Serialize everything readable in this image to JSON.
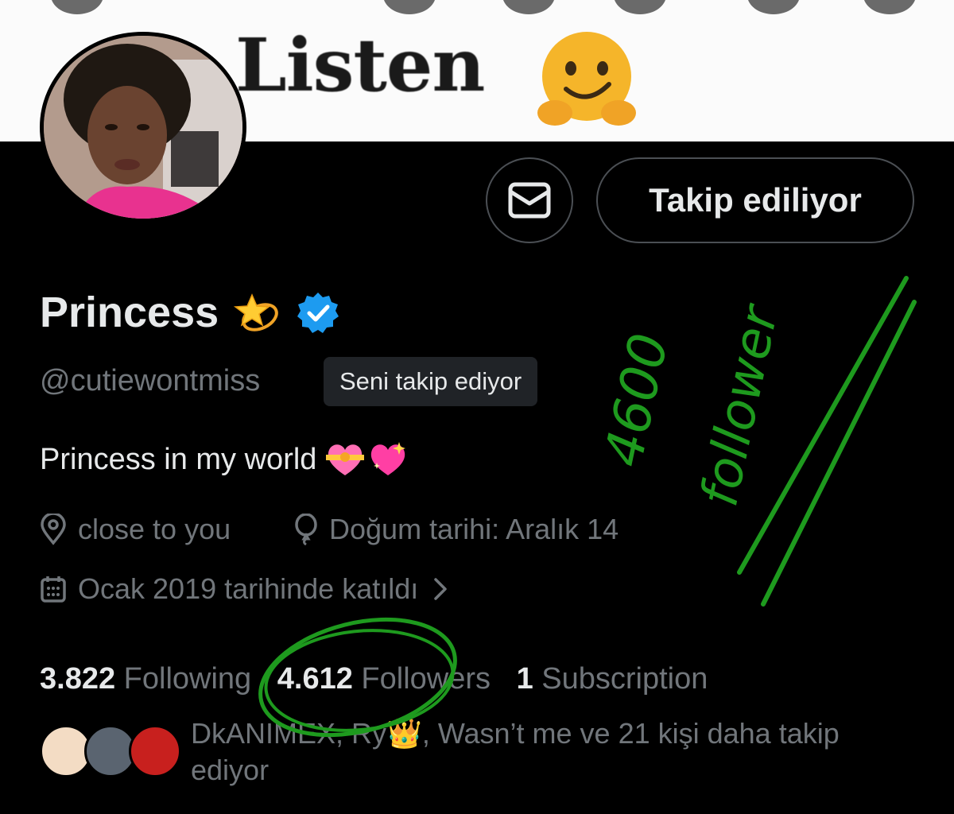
{
  "banner": {
    "text": "Listen"
  },
  "actions": {
    "follow_label": "Takip ediliyor"
  },
  "profile": {
    "name": "Princess",
    "handle": "@cutiewontmiss",
    "follows_you": "Seni takip ediyor",
    "bio": "Princess in my world"
  },
  "meta": {
    "location": "close to you",
    "birthday": "Doğum tarihi: Aralık 14",
    "joined": "Ocak 2019 tarihinde katıldı"
  },
  "stats": {
    "following_count": "3.822",
    "following_label": "Following",
    "followers_count": "4.612",
    "followers_label": "Followers",
    "subscription_count": "1",
    "subscription_label": "Subscription"
  },
  "followed_by": {
    "text": "DkANIMEX, Ry👑, Wasn’t me ve 21 kişi daha takip ediyor"
  },
  "annotation": {
    "line1": "4600",
    "line2": "follower",
    "color": "#1e9a1e"
  },
  "colors": {
    "text_primary": "#e7e9ea",
    "text_secondary": "#71767b",
    "verified_blue": "#1d9bf0",
    "badge_bg": "#202327"
  }
}
